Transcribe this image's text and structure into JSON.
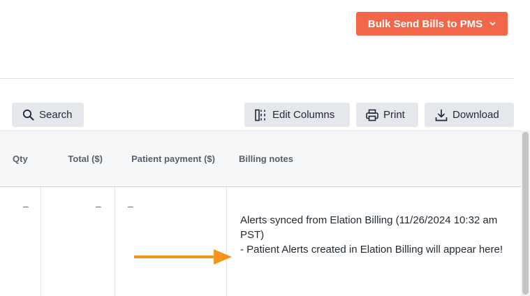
{
  "header": {
    "bulk_send_label": "Bulk Send Bills to PMS",
    "bulk_send_chevron": "⌄"
  },
  "toolbar": {
    "search_label": "Search",
    "edit_columns_label": "Edit Columns",
    "print_label": "Print",
    "download_label": "Download"
  },
  "icons": {
    "search": "search-icon",
    "edit_columns": "columns-icon",
    "print": "printer-icon",
    "download": "download-icon",
    "arrow": "arrow-right-icon"
  },
  "colors": {
    "accent": "#f26649",
    "annotation_arrow": "#f7941d"
  },
  "table": {
    "columns": [
      "Qty",
      "Total ($)",
      "Patient payment ($)",
      "Billing notes"
    ],
    "rows": [
      {
        "qty": "–",
        "total": "–",
        "patient_payment": "–",
        "billing_notes_line1": "Alerts synced from Elation Billing (11/26/2024 10:32 am PST)",
        "billing_notes_line2": "- Patient Alerts created in Elation Billing will appear here!"
      }
    ]
  }
}
